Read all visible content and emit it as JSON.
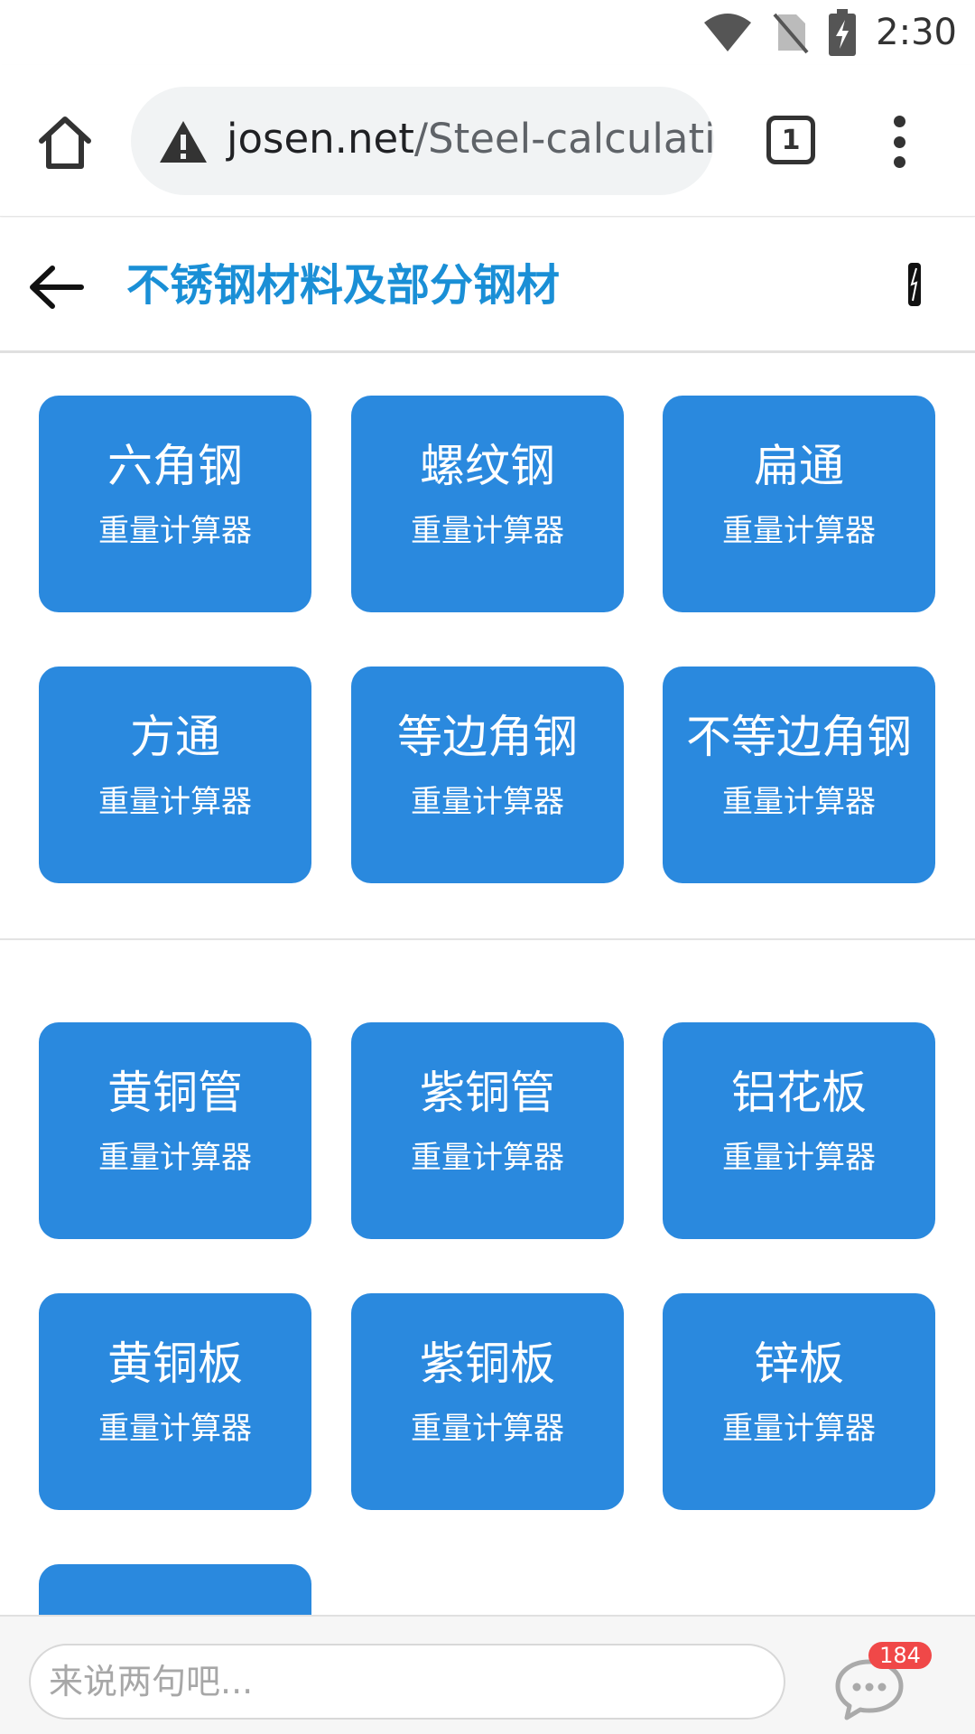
{
  "status_bar": {
    "time": "2:30",
    "icons": [
      "wifi-icon",
      "no-sim-icon",
      "battery-charging-icon"
    ]
  },
  "browser": {
    "url_host": "josen.net",
    "url_path": "/Steel-calculati",
    "tab_count": "1",
    "icons": [
      "home-icon",
      "not-secure-warning-icon",
      "tabs-icon",
      "more-menu-icon"
    ]
  },
  "header": {
    "title": "不锈钢材料及部分钢材",
    "title_color": "#1a8fd6"
  },
  "colors": {
    "tile_background": "#2a89de",
    "badge_background": "#f04848"
  },
  "section1": {
    "tiles": [
      {
        "title": "六角钢",
        "subtitle": "重量计算器"
      },
      {
        "title": "螺纹钢",
        "subtitle": "重量计算器"
      },
      {
        "title": "扁通",
        "subtitle": "重量计算器"
      },
      {
        "title": "方通",
        "subtitle": "重量计算器"
      },
      {
        "title": "等边角钢",
        "subtitle": "重量计算器"
      },
      {
        "title": "不等边角钢",
        "subtitle": "重量计算器"
      }
    ]
  },
  "section2": {
    "tiles": [
      {
        "title": "黄铜管",
        "subtitle": "重量计算器"
      },
      {
        "title": "紫铜管",
        "subtitle": "重量计算器"
      },
      {
        "title": "铝花板",
        "subtitle": "重量计算器"
      },
      {
        "title": "黄铜板",
        "subtitle": "重量计算器"
      },
      {
        "title": "紫铜板",
        "subtitle": "重量计算器"
      },
      {
        "title": "锌板",
        "subtitle": "重量计算器"
      }
    ]
  },
  "comment_bar": {
    "placeholder": "来说两句吧...",
    "comment_count": "184"
  }
}
